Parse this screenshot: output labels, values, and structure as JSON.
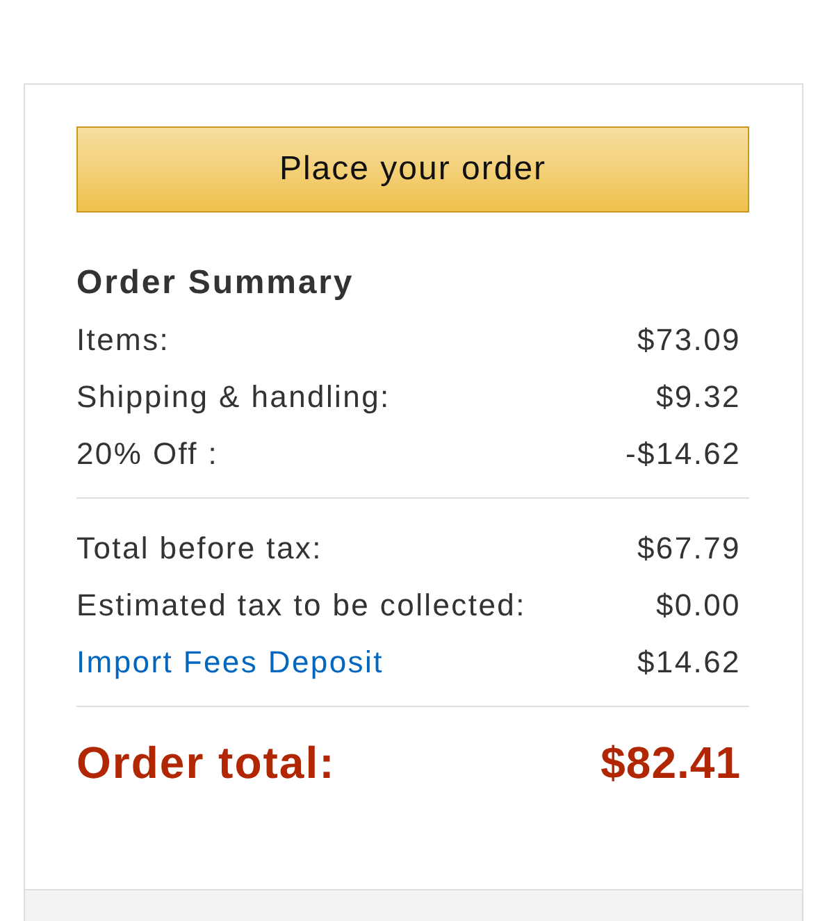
{
  "button": {
    "label": "Place your order"
  },
  "summary": {
    "title": "Order Summary",
    "groups": [
      {
        "rows": [
          {
            "kind": "plain",
            "label": "Items:",
            "value": "$73.09"
          },
          {
            "kind": "plain",
            "label": "Shipping & handling:",
            "value": "$9.32"
          },
          {
            "kind": "plain",
            "label": "20% Off :",
            "value": "-$14.62"
          }
        ]
      },
      {
        "rows": [
          {
            "kind": "plain",
            "label": "Total before tax:",
            "value": "$67.79"
          },
          {
            "kind": "plain",
            "label": "Estimated tax to be collected:",
            "value": "$0.00"
          },
          {
            "kind": "link",
            "label": "Import Fees Deposit",
            "value": "$14.62"
          }
        ]
      }
    ],
    "total": {
      "label": "Order total:",
      "value": "$82.41"
    }
  }
}
